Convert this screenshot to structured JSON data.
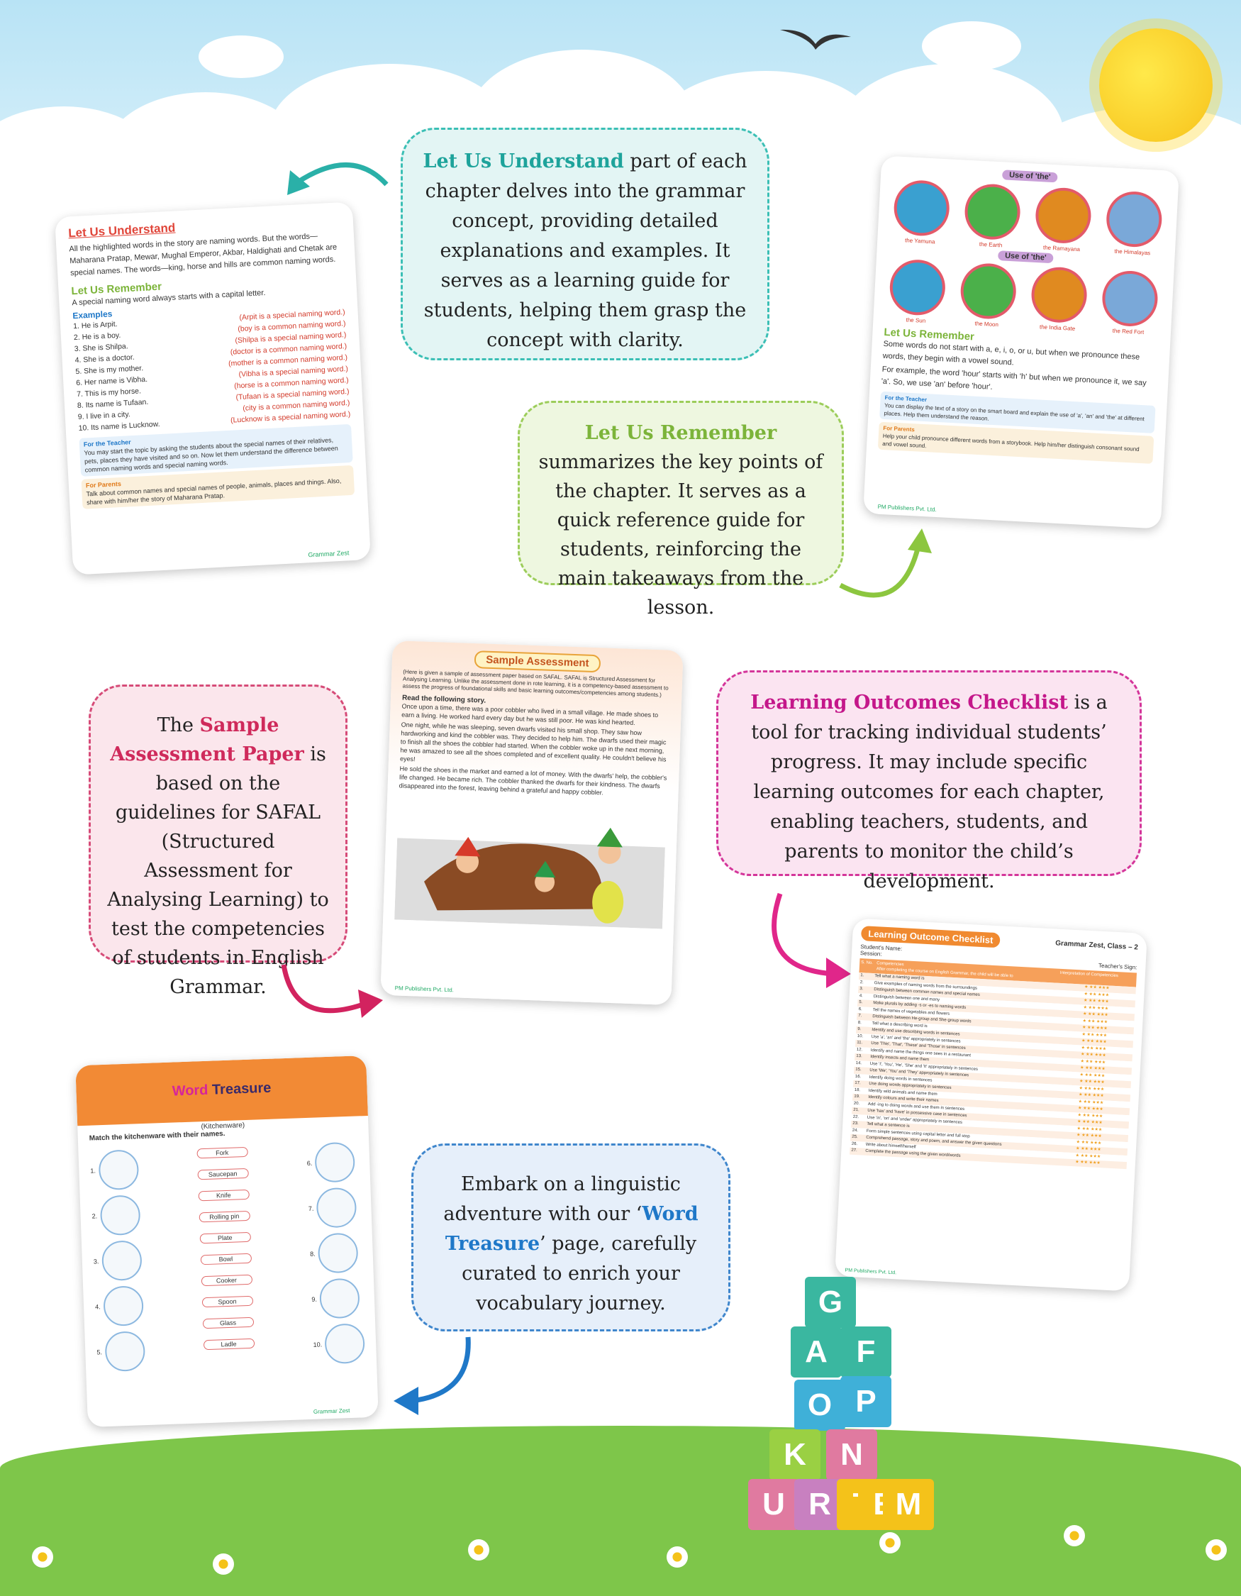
{
  "bubbles": {
    "understand": {
      "title": "Let Us Understand",
      "text": " part of each chapter delves into the grammar concept, providing detailed explanations and examples. It serves as a learning guide for students, helping them grasp the concept with clarity."
    },
    "remember": {
      "title": "Let Us Remember",
      "text": " summarizes the key points of the chapter. It serves as a quick reference guide for students, reinforcing the main takeaways from the lesson."
    },
    "assessment": {
      "pre": "The ",
      "title": "Sample Assessment Paper",
      "text": " is based on the guidelines for SAFAL (Structured Assessment for Analysing Learning) to test the competencies of students in English Grammar."
    },
    "checklist": {
      "title": "Learning Outcomes Checklist",
      "text": " is a tool for tracking individual students’ progress. It may include specific learning outcomes for each chapter, enabling teachers, students, and parents to monitor the child’s development."
    },
    "treasure": {
      "pre": "Embark on a linguistic adventure with our ‘",
      "title": "Word Treasure",
      "text": "’ page, carefully curated to enrich your vocabulary journey."
    }
  },
  "page1": {
    "title": "Let Us Understand",
    "intro": "All the highlighted words in the story are naming words. But the words—Maharana Pratap, Mewar, Mughal Emperor, Akbar, Haldighati and Chetak are special names. The words—king, horse and hills are common naming words.",
    "remember_title": "Let Us Remember",
    "rule": "A special naming word always starts with a capital letter.",
    "examples_label": "Examples",
    "examples": [
      {
        "s": "1.  He is Arpit.",
        "n": "(Arpit is a special naming word.)"
      },
      {
        "s": "2.  He is a boy.",
        "n": "(boy is a common naming word.)"
      },
      {
        "s": "3.  She is Shilpa.",
        "n": "(Shilpa is a special naming word.)"
      },
      {
        "s": "4.  She is a doctor.",
        "n": "(doctor is a common naming word.)"
      },
      {
        "s": "5.  She is my mother.",
        "n": "(mother is a common naming word.)"
      },
      {
        "s": "6.  Her name is Vibha.",
        "n": "(Vibha is a special naming word.)"
      },
      {
        "s": "7.  This is my horse.",
        "n": "(horse is a common naming word.)"
      },
      {
        "s": "8.  Its name is Tufaan.",
        "n": "(Tufaan is a special naming word.)"
      },
      {
        "s": "9.  I live in a city.",
        "n": "(city is a common naming word.)"
      },
      {
        "s": "10. Its name is Lucknow.",
        "n": "(Lucknow is a special naming word.)"
      }
    ],
    "teacher_label": "For the Teacher",
    "teacher_text": "You may start the topic by asking the students about the special names of their relatives, pets, places they have visited and so on. Now let them understand the difference between common naming words and special naming words.",
    "parents_label": "For Parents",
    "parents_text": "Talk about common names and special names of people, animals, places and things. Also, share with him/her the story of Maharana Pratap.",
    "footer": "Grammar Zest"
  },
  "page2": {
    "use_the": "Use of 'the'",
    "row1": [
      "the Yamuna",
      "the Earth",
      "the Ramayana",
      "the Himalayas"
    ],
    "row2": [
      "the Sun",
      "the Moon",
      "the India Gate",
      "the Red Fort"
    ],
    "remember_title": "Let Us Remember",
    "text1": "Some words do not start with a, e, i, o, or u, but when we pronounce these words, they begin with a vowel sound.",
    "text2": "For example, the word 'hour' starts with 'h' but when we pronounce it, we say 'a'. So, we use 'an' before 'hour'.",
    "teacher_label": "For the Teacher",
    "teacher_text": "You can display the text of a story on the smart board and explain the use of 'a', 'an' and 'the' at different places. Help them understand the reason.",
    "parents_label": "For Parents",
    "parents_text": "Help your child pronounce different words from a storybook. Help him/her distinguish consonant sound and vowel sound.",
    "footer": "PM Publishers Pvt. Ltd."
  },
  "page3": {
    "title": "Sample Assessment",
    "intro": "(Here is given a sample of assessment paper based on SAFAL. SAFAL is Structured Assessment for Analysing Learning. Unlike the assessment done in rote learning, it is a competency-based assessment to assess the progress of foundational skills and basic learning outcomes/competencies among students.)",
    "heading": "Read the following story.",
    "p1": "Once upon a time, there was a poor cobbler who lived in a small village. He made shoes to earn a living. He worked hard every day but he was still poor. He was kind hearted.",
    "p2": "One night, while he was sleeping, seven dwarfs visited his small shop. They saw how hardworking and kind the cobbler was. They decided to help him. The dwarfs used their magic to finish all the shoes the cobbler had started. When the cobbler woke up in the next morning, he was amazed to see all the shoes completed and of excellent quality. He couldn't believe his eyes!",
    "p3": "He sold the shoes in the market and earned a lot of money. With the dwarfs' help, the cobbler's life changed. He became rich. The cobbler thanked the dwarfs for their kindness. The dwarfs disappeared into the forest, leaving behind a grateful and happy cobbler.",
    "footer": "PM Publishers Pvt. Ltd."
  },
  "page4": {
    "title": "Learning Outcome Checklist",
    "subtitle": "Grammar Zest, Class – 2",
    "student": "Student's Name: ",
    "session": "Session: ",
    "teacher": "Teacher's Sign: ",
    "col_sno": "S. No.",
    "col_comp": "After completing the course on English Grammar, the child will be able to",
    "col_comp_head": "Competencies",
    "col_interp": "Interpretation of Competencies",
    "items": [
      "Tell what a naming word is",
      "Give examples of naming words from the surroundings",
      "Distinguish between common names and special names",
      "Distinguish between one and many",
      "Make plurals by adding -s or -es to naming words",
      "Tell the names of vegetables and flowers",
      "Distinguish between He-group and She-group words",
      "Tell what a describing word is",
      "Identify and use describing words in sentences",
      "Use 'a', 'an' and 'the' appropriately in sentences",
      "Use 'This', 'That', 'These' and 'Those' in sentences",
      "Identify and name the things one sees in a restaurant",
      "Identify insects and name them",
      "Use 'I', 'You', 'He', 'She' and 'It' appropriately in sentences",
      "Use 'We', 'You' and 'They' appropriately in sentences",
      "Identify doing words in sentences",
      "Use doing words appropriately in sentences",
      "Identify wild animals and name them",
      "Identify colours and write their names",
      "Add -ing to doing words and use them in sentences",
      "Use 'has' and 'have' in possessive case in sentences",
      "Use 'in', 'on' and 'under' appropriately in sentences",
      "Tell what a sentence is",
      "Form simple sentences using capital letter and full stop",
      "Comprehend passage, story and poem, and answer the given questions",
      "Write about himself/herself",
      "Complete the passage using the given word/words"
    ],
    "stars": "★   ★★   ★★★",
    "footer": "PM Publishers Pvt. Ltd."
  },
  "page5": {
    "title_w": "Word",
    "title_t": " Treasure",
    "sub": "(Kitchenware)",
    "instruction": "Match the kitchenware with their names.",
    "left_nums": [
      "1.",
      "2.",
      "3.",
      "4.",
      "5."
    ],
    "right_nums": [
      "6.",
      "7.",
      "8.",
      "9.",
      "10."
    ],
    "words": [
      "Fork",
      "Saucepan",
      "Knife",
      "Rolling pin",
      "Plate",
      "Bowl",
      "Cooker",
      "Spoon",
      "Glass",
      "Ladle"
    ],
    "footer": "Grammar Zest"
  },
  "blocks": [
    "A",
    "F",
    "O",
    "P",
    "K",
    "N",
    "U",
    "R",
    "T",
    "E",
    "M",
    "G"
  ],
  "colors": {
    "teal": "#3bbfb5",
    "green": "#9ccd5a",
    "pink": "#d64b78",
    "magenta": "#d4359a",
    "blue": "#3f86cc",
    "grass": "#7ec64a",
    "sky": "#b8e3f5"
  }
}
